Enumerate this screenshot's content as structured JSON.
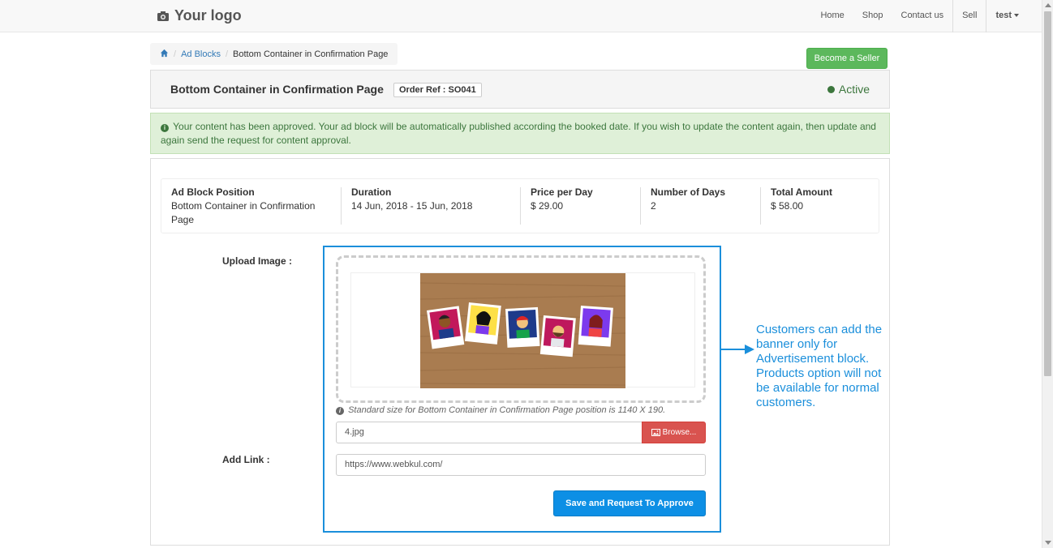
{
  "navbar": {
    "logo_text": "Your logo",
    "links": [
      "Home",
      "Shop",
      "Contact us",
      "Sell"
    ],
    "user": "test"
  },
  "breadcrumb": {
    "items": [
      "Ad Blocks",
      "Bottom Container in Confirmation Page"
    ]
  },
  "become_seller_label": "Become a Seller",
  "header": {
    "title": "Bottom Container in Confirmation Page",
    "order_ref": "Order Ref : SO041",
    "status": "Active",
    "status_color": "#3c763d"
  },
  "alert": {
    "message": "Your content has been approved. Your ad block will be automatically published according the booked date. If you wish to update the content again, then update and again send the request for content approval."
  },
  "summary": [
    {
      "label": "Ad Block Position",
      "value": "Bottom Container in Confirmation Page"
    },
    {
      "label": "Duration",
      "value": "14 Jun, 2018 - 15 Jun, 2018"
    },
    {
      "label": "Price per Day",
      "value": "$ 29.00"
    },
    {
      "label": "Number of Days",
      "value": "2"
    },
    {
      "label": "Total Amount",
      "value": "$ 58.00"
    }
  ],
  "form": {
    "upload_label": "Upload Image :",
    "hint": "Standard size for Bottom Container in Confirmation Page position is 1140 X 190.",
    "file_name": "4.jpg",
    "browse_label": "Browse...",
    "link_label": "Add Link :",
    "link_value": "https://www.webkul.com/",
    "submit_label": "Save and Request To Approve"
  },
  "callout": "Customers can add the banner only for Advertisement block. Products option will not be available for normal customers."
}
